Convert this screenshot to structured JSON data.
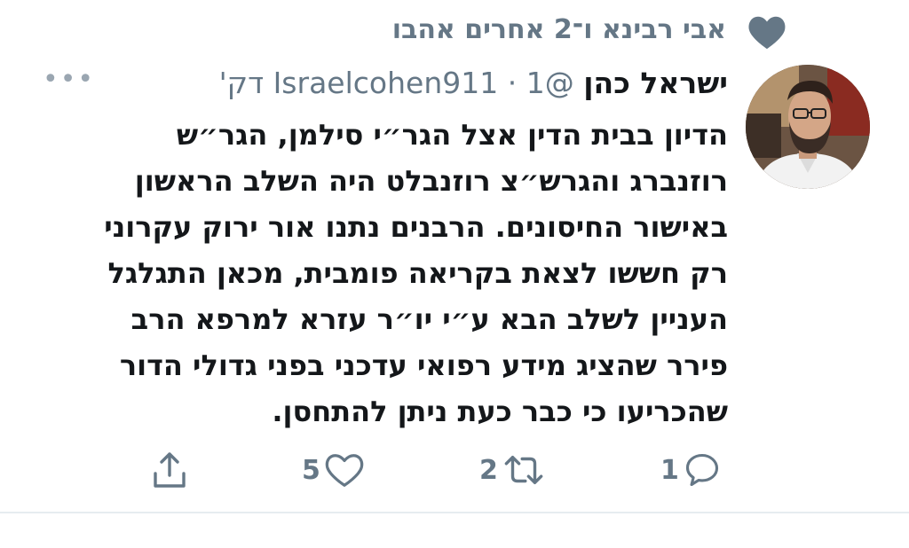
{
  "social_context": {
    "text": "אבי רבינא ו־2 אחרים אהבו",
    "icon": "heart-icon"
  },
  "tweet": {
    "author_name": "ישראל כהן",
    "handle": "@Israelcohen911",
    "separator": "·",
    "time": "1 דק'",
    "more_icon": "more-icon",
    "body_lines": [
      "הדיון בבית הדין אצל הגר״י סילמן, הגר״ש",
      "רוזנברג והגרש״צ רוזנבלט היה השלב הראשון",
      "באישור החיסונים. הרבנים נתנו אור ירוק עקרוני",
      "רק חששו לצאת בקריאה פומבית, מכאן התגלגל",
      "העניין לשלב הבא ע״י יו״ר עזרא למרפא הרב",
      "פירר שהציג מידע רפואי עדכני בפני גדולי הדור",
      "שהכריעו כי כבר כעת ניתן להתחסן."
    ]
  },
  "actions": {
    "reply_count": "1",
    "retweet_count": "2",
    "like_count": "5",
    "share_icon": "share-icon"
  },
  "colors": {
    "secondary_text": "#657786",
    "primary_text": "#14171a",
    "divider": "#e6ecf0"
  }
}
